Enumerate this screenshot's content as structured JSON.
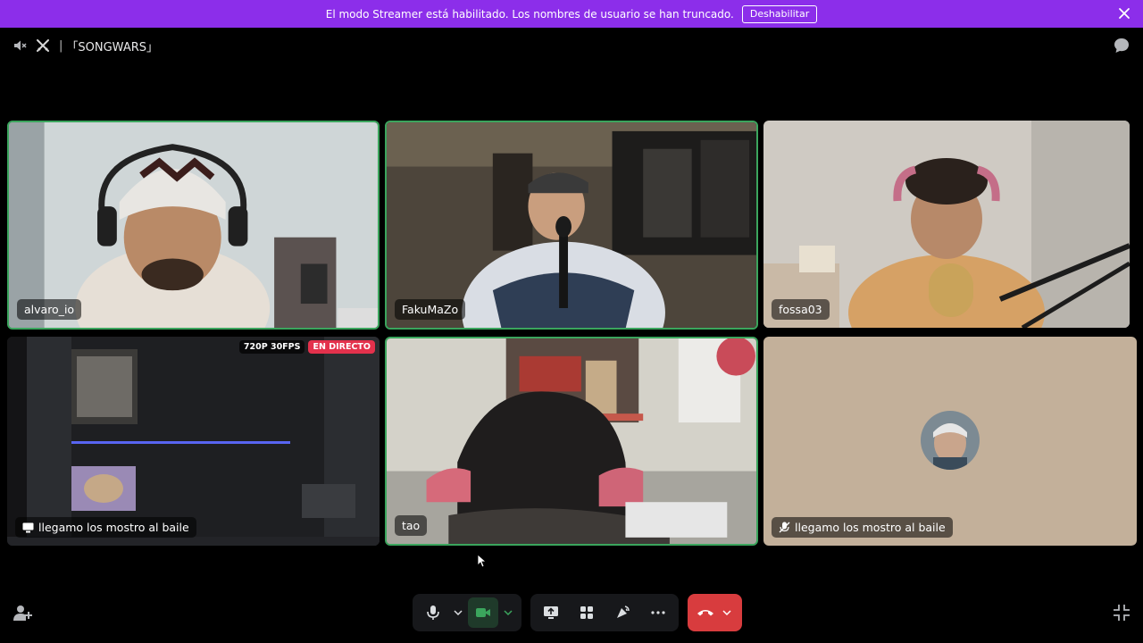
{
  "banner": {
    "message": "El modo Streamer está habilitado. Los nombres de usuario se han truncado.",
    "button_label": "Deshabilitar"
  },
  "header": {
    "channel_name": "「SONGWARS」",
    "separator": "|"
  },
  "participants": [
    {
      "name": "alvaro_io",
      "speaking": true
    },
    {
      "name": "FakuMaZo",
      "speaking": true
    },
    {
      "name": "fossa03",
      "speaking": false
    },
    {
      "name": "llegamo los mostro al baile",
      "stream": true,
      "badges": [
        "720P 30FPS",
        "EN DIRECTO"
      ]
    },
    {
      "name": "tao",
      "speaking": true
    },
    {
      "name": "llegamo los mostro al baile",
      "audio_only": true
    }
  ],
  "controls": {
    "mic": "microphone-icon",
    "camera": "camera-icon",
    "screen_share": "screen-share-icon",
    "activities": "activities-icon",
    "soundboard": "soundboard-icon",
    "more": "more-icon",
    "disconnect": "disconnect-icon"
  },
  "colors": {
    "banner": "#8c2eea",
    "speaking_border": "#3ba55d",
    "live_badge": "#e3314c",
    "disconnect": "#d83c3e"
  }
}
